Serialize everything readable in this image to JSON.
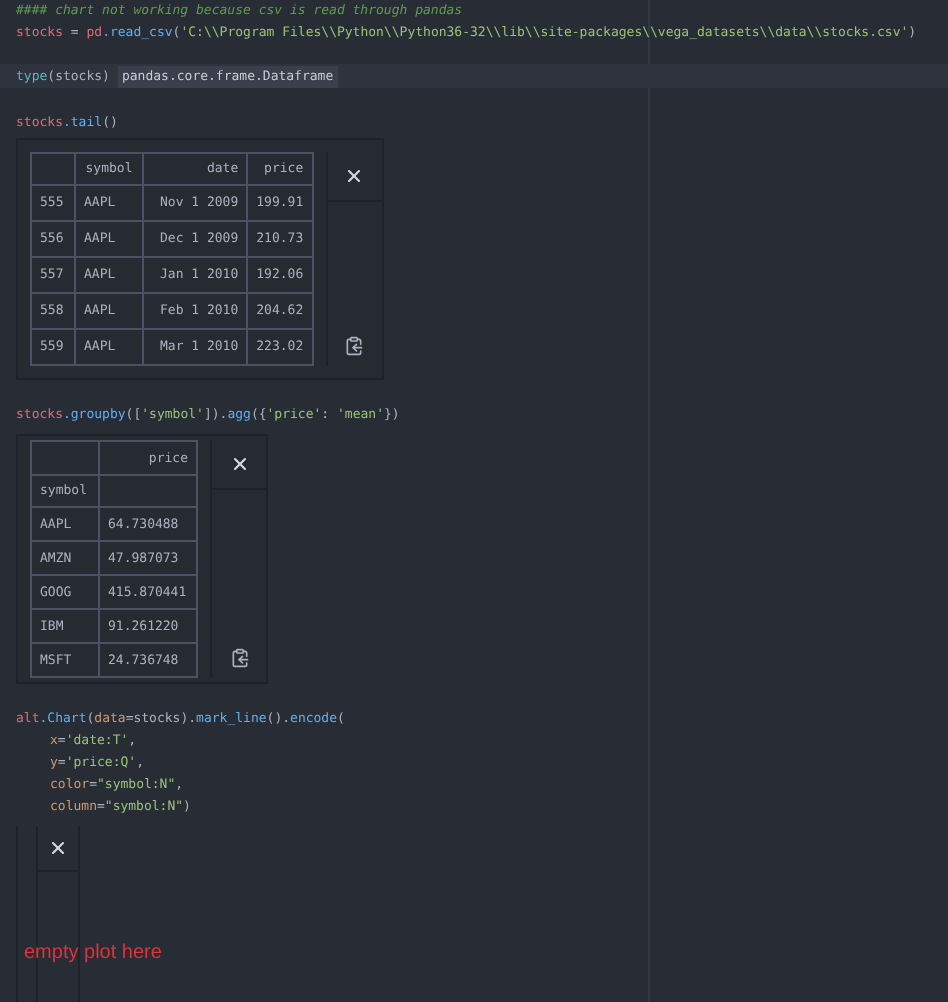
{
  "blocks": [
    {
      "kind": "code",
      "lines": [
        [
          {
            "kind": "comment",
            "text": "#### chart not working because csv is read through pandas"
          }
        ],
        [
          {
            "kind": "var",
            "text": "stocks"
          },
          {
            "kind": "plain",
            "text": " = "
          },
          {
            "kind": "var",
            "text": "pd"
          },
          {
            "kind": "func",
            "text": ".read_csv"
          },
          {
            "kind": "plain",
            "text": "("
          },
          {
            "kind": "string",
            "text": "'C:\\\\Program Files\\\\Python\\\\Python36-32\\\\lib\\\\site-packages\\\\vega_datasets\\\\data\\\\stocks.csv'"
          },
          {
            "kind": "plain",
            "text": ")"
          }
        ]
      ]
    },
    {
      "kind": "inline",
      "code": [
        {
          "kind": "builtin",
          "text": "type"
        },
        {
          "kind": "plain",
          "text": "(stocks)"
        }
      ],
      "result": "pandas.core.frame.Dataframe"
    },
    {
      "kind": "code",
      "lines": [
        [
          {
            "kind": "var",
            "text": "stocks"
          },
          {
            "kind": "func",
            "text": ".tail"
          },
          {
            "kind": "plain",
            "text": "()"
          }
        ]
      ]
    },
    {
      "kind": "table",
      "columns": [
        "symbol",
        "date",
        "price"
      ],
      "rows": [
        {
          "index": "555",
          "cells": [
            "AAPL",
            "Nov 1 2009",
            "199.91"
          ]
        },
        {
          "index": "556",
          "cells": [
            "AAPL",
            "Dec 1 2009",
            "210.73"
          ]
        },
        {
          "index": "557",
          "cells": [
            "AAPL",
            "Jan 1 2010",
            "192.06"
          ]
        },
        {
          "index": "558",
          "cells": [
            "AAPL",
            "Feb 1 2010",
            "204.62"
          ]
        },
        {
          "index": "559",
          "cells": [
            "AAPL",
            "Mar 1 2010",
            "223.02"
          ]
        }
      ]
    },
    {
      "kind": "code",
      "lines": [
        [
          {
            "kind": "var",
            "text": "stocks"
          },
          {
            "kind": "func",
            "text": ".groupby"
          },
          {
            "kind": "plain",
            "text": "(["
          },
          {
            "kind": "string",
            "text": "'symbol'"
          },
          {
            "kind": "plain",
            "text": "])."
          },
          {
            "kind": "func",
            "text": "agg"
          },
          {
            "kind": "plain",
            "text": "({"
          },
          {
            "kind": "string",
            "text": "'price'"
          },
          {
            "kind": "plain",
            "text": ": "
          },
          {
            "kind": "string",
            "text": "'mean'"
          },
          {
            "kind": "plain",
            "text": "})"
          }
        ]
      ]
    },
    {
      "kind": "grouped_table",
      "columns": [
        "price"
      ],
      "index_name": "symbol",
      "rows": [
        {
          "index": "AAPL",
          "cells": [
            "64.730488"
          ]
        },
        {
          "index": "AMZN",
          "cells": [
            "47.987073"
          ]
        },
        {
          "index": "GOOG",
          "cells": [
            "415.870441"
          ]
        },
        {
          "index": "IBM",
          "cells": [
            "91.261220"
          ]
        },
        {
          "index": "MSFT",
          "cells": [
            "24.736748"
          ]
        }
      ]
    },
    {
      "kind": "code",
      "lines": [
        [
          {
            "kind": "var",
            "text": "alt"
          },
          {
            "kind": "func",
            "text": ".Chart"
          },
          {
            "kind": "plain",
            "text": "("
          },
          {
            "kind": "kwarg",
            "text": "data"
          },
          {
            "kind": "plain",
            "text": "=stocks)."
          },
          {
            "kind": "func",
            "text": "mark_line"
          },
          {
            "kind": "plain",
            "text": "()."
          },
          {
            "kind": "func",
            "text": "encode"
          },
          {
            "kind": "plain",
            "text": "("
          }
        ],
        [
          {
            "kind": "kwarg",
            "text": "x"
          },
          {
            "kind": "plain",
            "text": "="
          },
          {
            "kind": "string",
            "text": "'date:T'"
          },
          {
            "kind": "plain",
            "text": ","
          }
        ],
        [
          {
            "kind": "kwarg",
            "text": "y"
          },
          {
            "kind": "plain",
            "text": "="
          },
          {
            "kind": "string",
            "text": "'price:Q'"
          },
          {
            "kind": "plain",
            "text": ","
          }
        ],
        [
          {
            "kind": "kwarg",
            "text": "color"
          },
          {
            "kind": "plain",
            "text": "="
          },
          {
            "kind": "string",
            "text": "\"symbol:N\""
          },
          {
            "kind": "plain",
            "text": ","
          }
        ],
        [
          {
            "kind": "kwarg",
            "text": "column"
          },
          {
            "kind": "plain",
            "text": "="
          },
          {
            "kind": "string",
            "text": "\"symbol:N\""
          },
          {
            "kind": "plain",
            "text": ")"
          }
        ]
      ]
    },
    {
      "kind": "empty_output",
      "note": "empty plot here"
    }
  ]
}
